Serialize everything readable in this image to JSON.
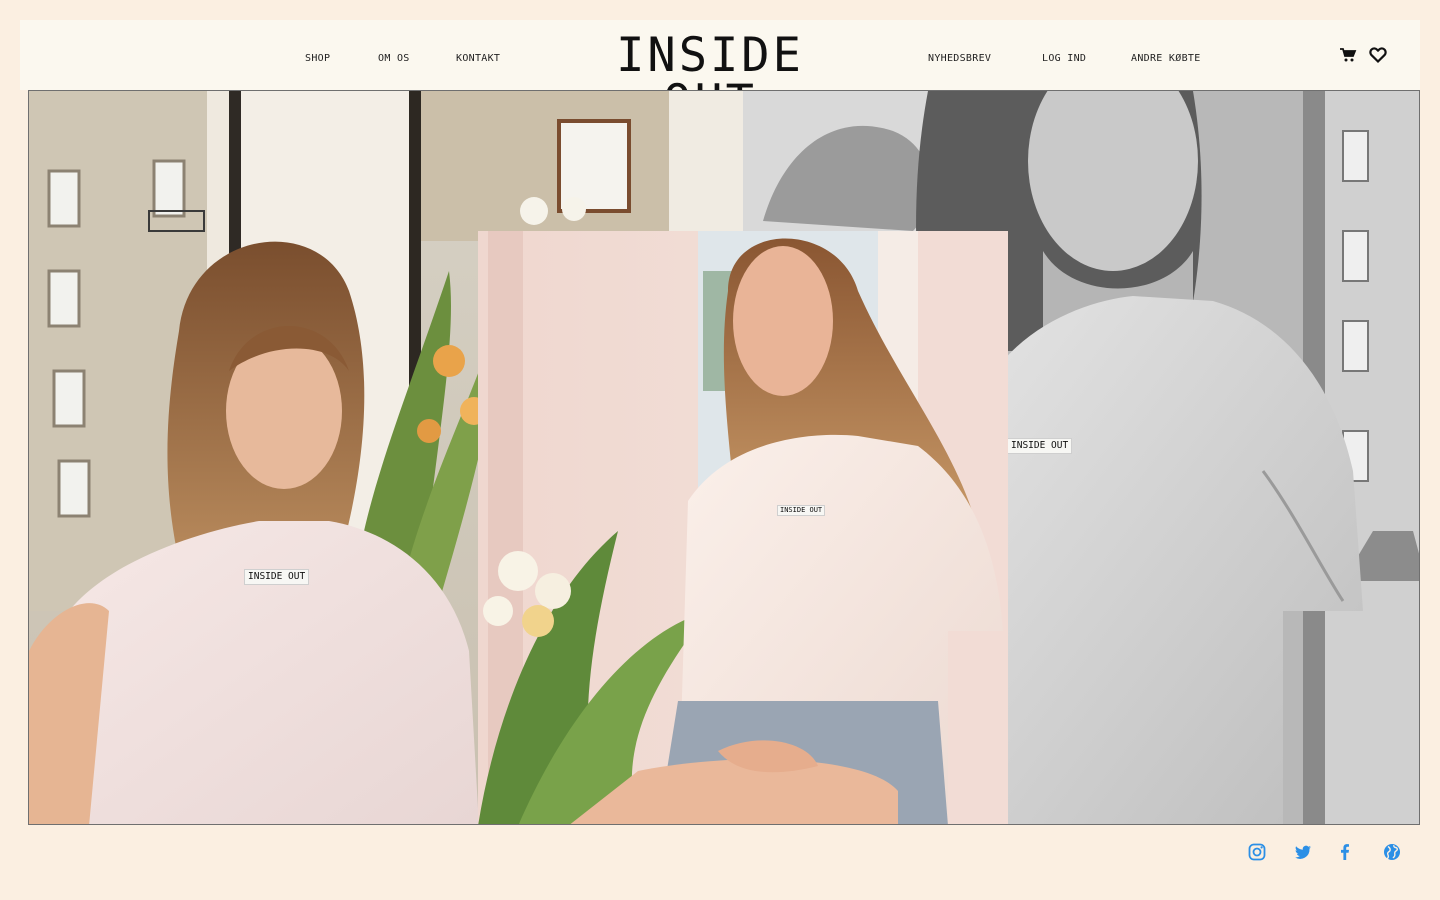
{
  "brand": {
    "logo": "INSIDE OUT"
  },
  "nav": {
    "left": [
      {
        "label": "SHOP"
      },
      {
        "label": "OM OS"
      },
      {
        "label": "KONTAKT"
      }
    ],
    "right": [
      {
        "label": "NYHEDSBREV"
      },
      {
        "label": "LOG IND"
      },
      {
        "label": "ANDRE KØBTE"
      }
    ]
  },
  "header_icons": [
    "cart-icon",
    "heart-icon"
  ],
  "hero": {
    "shirt_labels": [
      "INSIDE OUT",
      "INSIDE OUT",
      "INSIDE OUT"
    ]
  },
  "socials": [
    "instagram-icon",
    "twitter-icon",
    "facebook-icon",
    "globe-icon"
  ],
  "colors": {
    "page_bg": "#fbefe1",
    "header_bg": "#fbf8ef",
    "social_blue": "#2b8fe6",
    "text": "#111111"
  }
}
